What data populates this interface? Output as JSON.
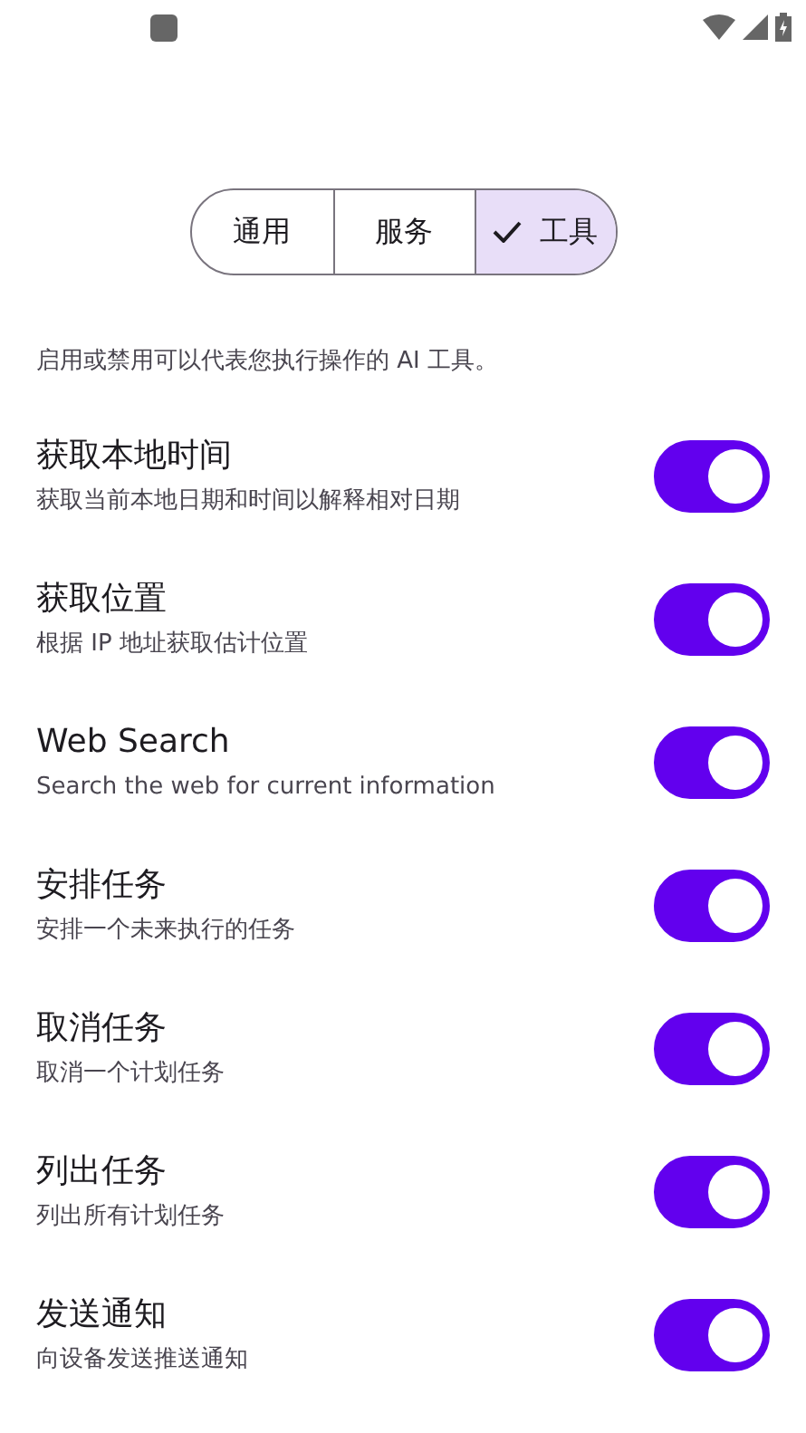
{
  "segments": [
    {
      "label": "通用",
      "selected": false
    },
    {
      "label": "服务",
      "selected": false
    },
    {
      "label": "工具",
      "selected": true
    }
  ],
  "description": "启用或禁用可以代表您执行操作的 AI 工具。",
  "tools": [
    {
      "title": "获取本地时间",
      "subtitle": "获取当前本地日期和时间以解释相对日期",
      "on": true
    },
    {
      "title": "获取位置",
      "subtitle": "根据 IP 地址获取估计位置",
      "on": true
    },
    {
      "title": "Web Search",
      "subtitle": "Search the web for current information",
      "on": true
    },
    {
      "title": "安排任务",
      "subtitle": "安排一个未来执行的任务",
      "on": true
    },
    {
      "title": "取消任务",
      "subtitle": "取消一个计划任务",
      "on": true
    },
    {
      "title": "列出任务",
      "subtitle": "列出所有计划任务",
      "on": true
    },
    {
      "title": "发送通知",
      "subtitle": "向设备发送推送通知",
      "on": true
    }
  ]
}
